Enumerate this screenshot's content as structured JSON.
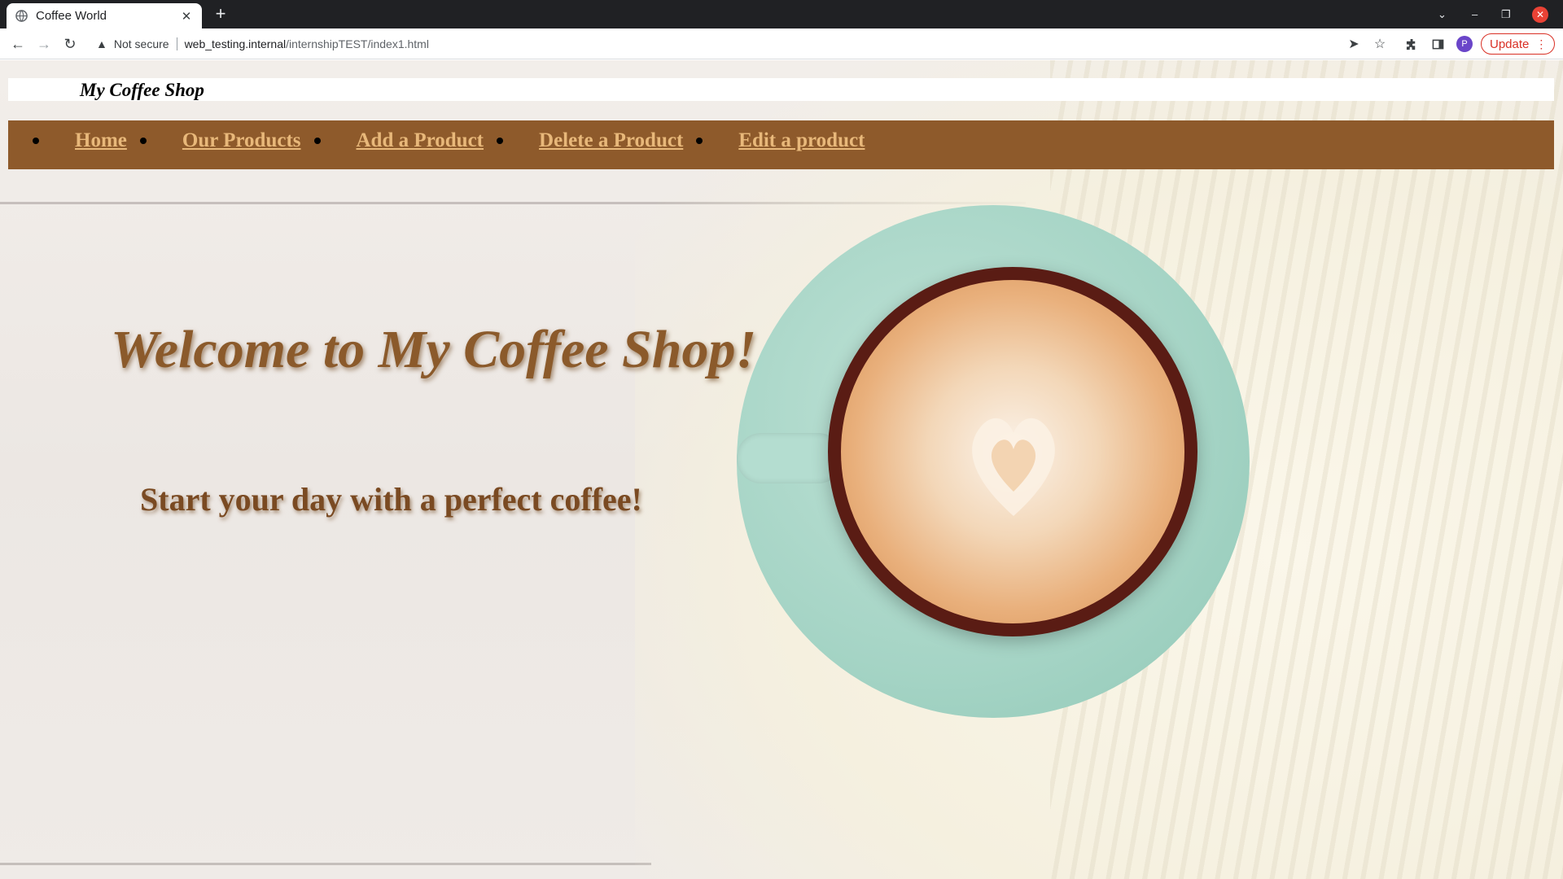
{
  "browser": {
    "tab_title": "Coffee World",
    "tab_close": "✕",
    "new_tab": "+",
    "security_label": "Not secure",
    "url_host": "web_testing.internal",
    "url_path": "/internshipTEST/index1.html",
    "update_label": "Update",
    "profile_initial": "P"
  },
  "site": {
    "header_title": "My Coffee Shop",
    "nav_items": [
      {
        "label": "Home"
      },
      {
        "label": "Our Products"
      },
      {
        "label": "Add a Product"
      },
      {
        "label": "Delete a Product"
      },
      {
        "label": "Edit a product"
      }
    ],
    "hero_title": "Welcome to My Coffee Shop!",
    "hero_subtitle": "Start your day with a perfect coffee!"
  },
  "colors": {
    "nav_background": "#8e5a2b",
    "nav_link": "#e8b87a",
    "hero_text": "#8b5a2b",
    "update_accent": "#d93025"
  },
  "icons": [
    "globe-icon",
    "close-icon",
    "plus-icon",
    "chevron-down-icon",
    "minimize-icon",
    "restore-icon",
    "window-close-icon",
    "back-icon",
    "forward-icon",
    "reload-icon",
    "warning-icon",
    "send-icon",
    "star-icon",
    "extensions-icon",
    "side-panel-icon",
    "kebab-menu-icon"
  ]
}
